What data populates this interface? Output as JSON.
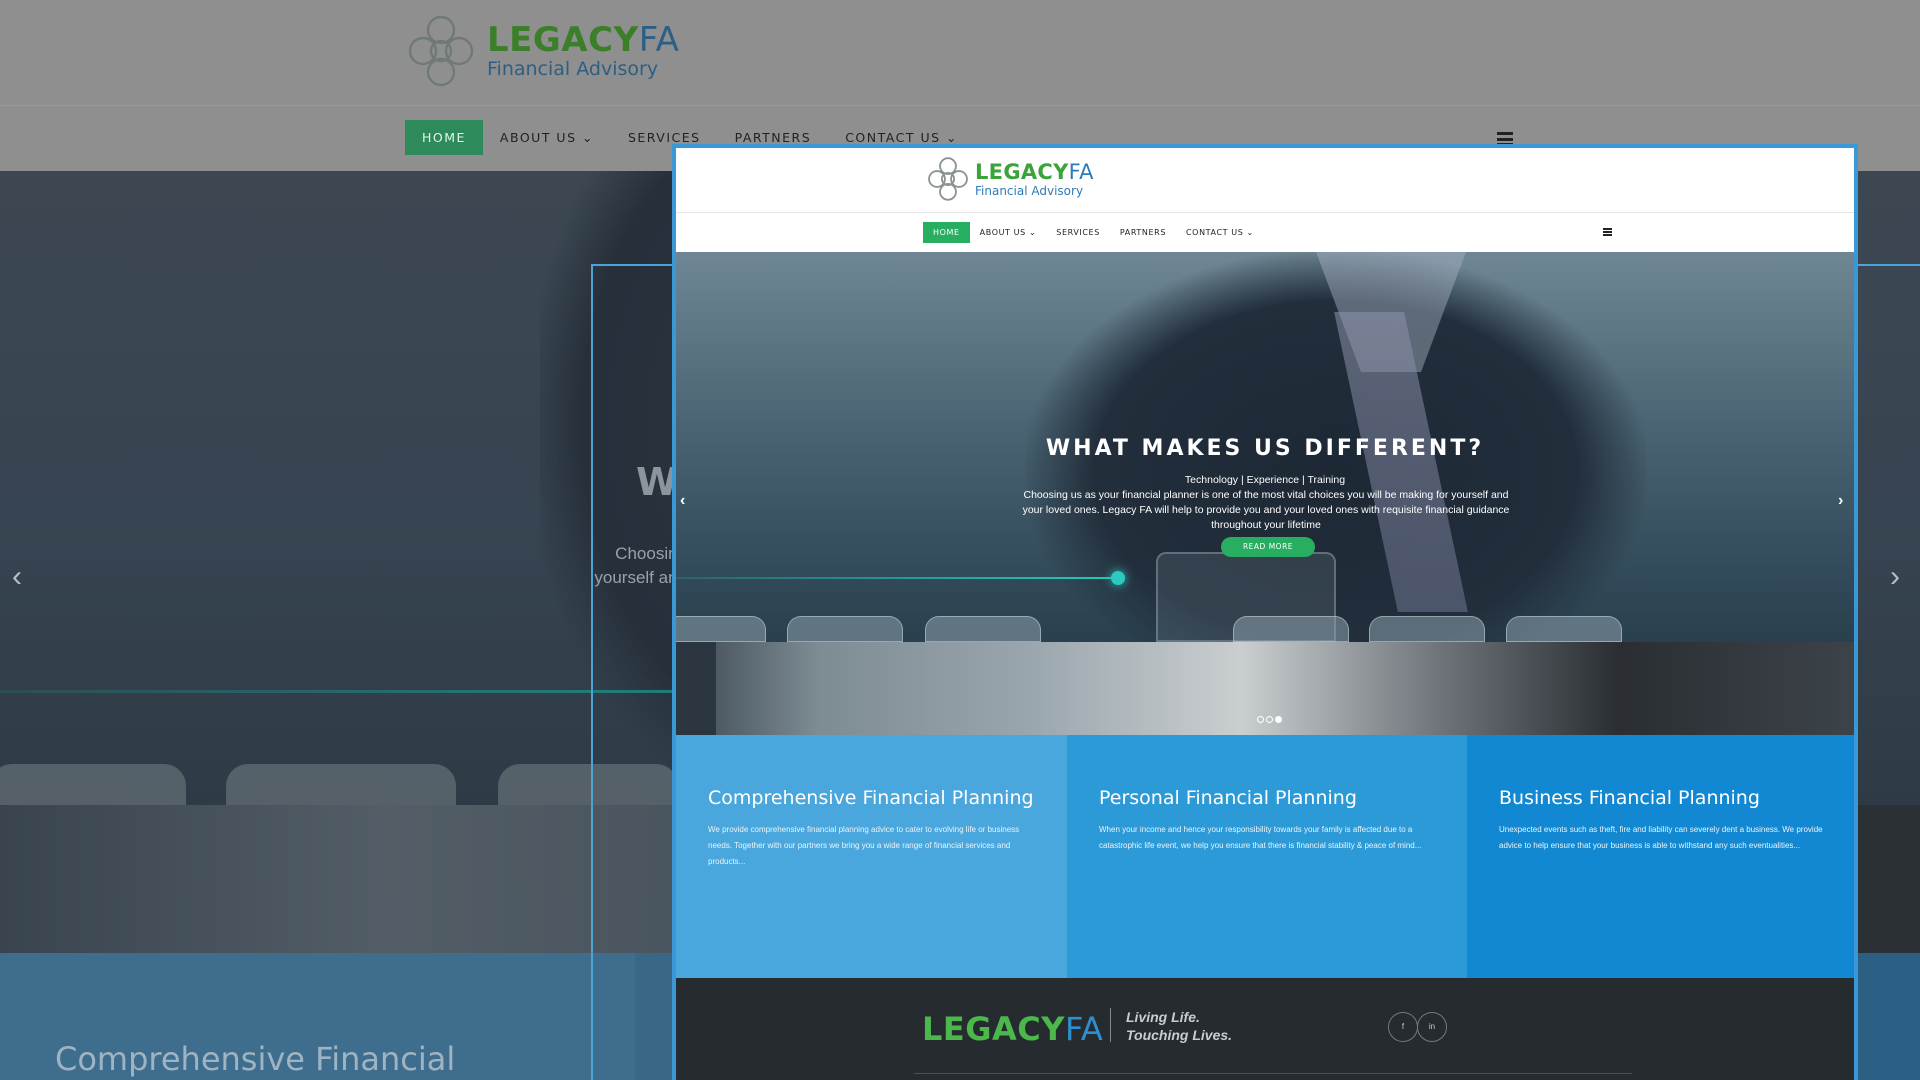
{
  "background": {
    "brand_main": "LEGACY",
    "brand_fa": "FA",
    "brand_sub": "Financial Advisory",
    "nav": [
      "HOME",
      "ABOUT US ⌄",
      "SERVICES",
      "PARTNERS",
      "CONTACT US ⌄"
    ],
    "hero_title_fragment": "W",
    "hero_text_fragment": "Choosing yourself and",
    "card_title_fragment": "Comprehensive Financial",
    "prev_arrow": "‹",
    "next_arrow": "›"
  },
  "site": {
    "brand_main": "LEGACY",
    "brand_fa": "FA",
    "brand_sub": "Financial Advisory",
    "nav": [
      "HOME",
      "ABOUT US ⌄",
      "SERVICES",
      "PARTNERS",
      "CONTACT US ⌄"
    ],
    "active_nav": "HOME",
    "hero": {
      "title": "WHAT MAKES US DIFFERENT?",
      "subtitle": "Technology | Experience | Training",
      "description": "Choosing us as your financial planner is one of the most vital choices you will be making for yourself and your loved ones. Legacy FA will help to provide you and your loved ones with requisite financial guidance throughout your lifetime",
      "button": "READ MORE",
      "prev_arrow": "‹",
      "next_arrow": "›",
      "slides_total": 3,
      "active_slide": 3
    },
    "cards": [
      {
        "title": "Comprehensive Financial Planning",
        "text": "We provide comprehensive financial planning advice to cater to evolving life or business needs. Together with our partners we bring you a wide range of financial services and products...",
        "color": "#4aa7dd"
      },
      {
        "title": "Personal Financial Planning",
        "text": "When your income and hence your responsibility towards your family is affected due to a catastrophic life event, we help you ensure that there is financial stability & peace of mind...",
        "color": "#2d9ad8"
      },
      {
        "title": "Business Financial Planning",
        "text": "Unexpected events such as theft, fire and liability can severely dent a business. We provide advice to help ensure that your business is able to withstand any such eventualities...",
        "color": "#1388d2"
      }
    ],
    "footer": {
      "brand_main": "LEGACY",
      "brand_fa": "FA",
      "tagline_1": "Living Life.",
      "tagline_2": "Touching Lives.",
      "social": [
        "f",
        "in"
      ]
    }
  },
  "colors": {
    "accent_green": "#27ae60",
    "frame_blue": "#3a98d6",
    "footer_dark": "#262b30"
  }
}
